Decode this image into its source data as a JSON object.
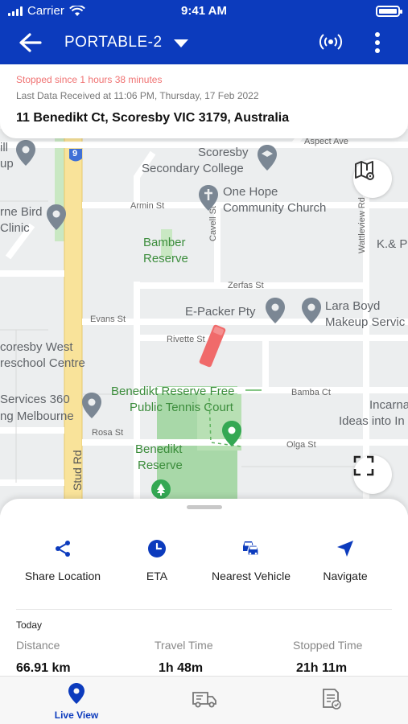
{
  "status_bar": {
    "carrier": "Carrier",
    "time": "9:41 AM"
  },
  "app_bar": {
    "vehicle_name": "PORTABLE-2"
  },
  "info": {
    "stopped": "Stopped since 1 hours 38 minutes",
    "last_data": "Last Data Received at 11:06 PM, Thursday, 17 Feb 2022",
    "address": "11 Benedikt Ct, Scoresby VIC 3179, Australia"
  },
  "map": {
    "labels": {
      "aspect_ave": "Aspect Ave",
      "scoresby_college_1": "Scoresby",
      "scoresby_college_2": "Secondary College",
      "one_hope_1": "One Hope",
      "one_hope_2": "Community Church",
      "armin_st": "Armin St",
      "cavell_st": "Cavell St",
      "wattleview_rd": "Wattleview Rd",
      "kp": "K.& P",
      "bamber_1": "Bamber",
      "bamber_2": "Reserve",
      "zerfas_st": "Zerfas St",
      "epacker": "E-Packer Pty",
      "lara_boyd_1": "Lara Boyd",
      "lara_boyd_2": "Makeup Servic",
      "evans_st": "Evans St",
      "rivette_st": "Rivette St",
      "scoresby_west_1": "coresby West",
      "scoresby_west_2": "reschool Centre",
      "tennis_1": "Benedikt Reserve Free",
      "tennis_2": "Public Tennis Court",
      "bamba_ct": "Bamba Ct",
      "incarna_1": "Incarna",
      "incarna_2": "Ideas into In",
      "services_1": "Services 360",
      "services_2": "ng Melbourne",
      "rosa_st": "Rosa St",
      "olga_st": "Olga St",
      "benedikt_res_1": "Benedikt",
      "benedikt_res_2": "Reserve",
      "stud_rd": "Stud Rd",
      "clinic_1": "rne Bird",
      "clinic_2": "Clinic",
      "mill_1": "ill",
      "mill_2": "up",
      "route_9": "9"
    }
  },
  "actions": [
    {
      "label": "Share Location",
      "icon": "share-icon"
    },
    {
      "label": "ETA",
      "icon": "clock-icon"
    },
    {
      "label": "Nearest Vehicle",
      "icon": "vehicles-icon"
    },
    {
      "label": "Navigate",
      "icon": "navigate-icon"
    }
  ],
  "summary": {
    "period": "Today",
    "distance_label": "Distance",
    "distance_value": "66.91 km",
    "travel_label": "Travel Time",
    "travel_value": "1h 48m",
    "stopped_label": "Stopped Time",
    "stopped_value": "21h 11m"
  },
  "nav": {
    "live_view": "Live View"
  },
  "colors": {
    "brand": "#0c3bbd",
    "stopped": "#f07272",
    "marker": "#f06a6a",
    "park": "#a8d8a8"
  }
}
